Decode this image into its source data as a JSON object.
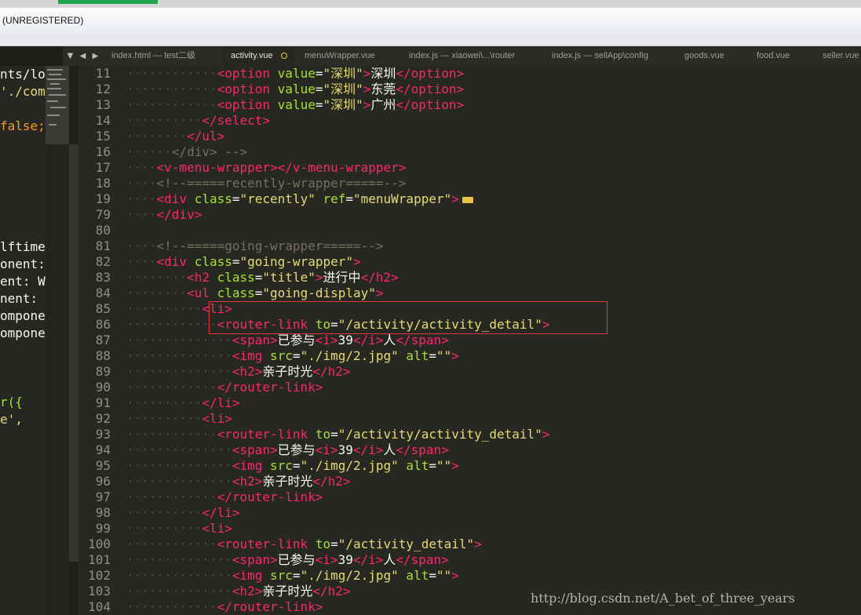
{
  "window": {
    "title": "(UNREGISTERED)"
  },
  "tabs": [
    {
      "label": "index.html — test二级",
      "active": false
    },
    {
      "label": "activity.vue",
      "active": true,
      "modified": true
    },
    {
      "label": "menuWrapper.vue",
      "active": false
    },
    {
      "label": "index.js — xiaowei\\...\\router",
      "active": false
    },
    {
      "label": "index.js — sellApp\\config",
      "active": false
    },
    {
      "label": "goods.vue",
      "active": false
    },
    {
      "label": "food.vue",
      "active": false
    },
    {
      "label": "seller.vue",
      "active": false
    }
  ],
  "tab_nav": {
    "menu": "▼",
    "prev": "◀",
    "next": "▶"
  },
  "side_pane": [
    {
      "text": "nts/lo",
      "kind": "txt"
    },
    {
      "text": "'./com",
      "kind": "str"
    },
    {
      "text": "",
      "kind": "txt"
    },
    {
      "text": "false;",
      "kind": "kw"
    },
    {
      "text": "",
      "kind": "txt"
    },
    {
      "text": "",
      "kind": "txt"
    },
    {
      "text": "",
      "kind": "txt"
    },
    {
      "text": "",
      "kind": "txt"
    },
    {
      "text": "",
      "kind": "txt"
    },
    {
      "text": "",
      "kind": "txt"
    },
    {
      "text": "lftime",
      "kind": "txt"
    },
    {
      "text": "onent:",
      "kind": "txt"
    },
    {
      "text": "ent: W",
      "kind": "txt"
    },
    {
      "text": "nent: ",
      "kind": "txt"
    },
    {
      "text": "ompone",
      "kind": "txt"
    },
    {
      "text": "ompone",
      "kind": "txt"
    },
    {
      "text": "",
      "kind": "txt"
    },
    {
      "text": "",
      "kind": "txt"
    },
    {
      "text": "",
      "kind": "txt"
    },
    {
      "text": "r({",
      "kind": "fn"
    },
    {
      "text": "e',",
      "kind": "str"
    }
  ],
  "code_lines": [
    {
      "n": "11",
      "indent": "············",
      "segs": [
        [
          "tag",
          "<option"
        ],
        [
          "attr",
          " value"
        ],
        [
          "txt",
          "="
        ],
        [
          "str",
          "\"深圳\""
        ],
        [
          "tag",
          ">"
        ],
        [
          "txt",
          "深圳"
        ],
        [
          "tag",
          "</option>"
        ]
      ]
    },
    {
      "n": "12",
      "indent": "············",
      "segs": [
        [
          "tag",
          "<option"
        ],
        [
          "attr",
          " value"
        ],
        [
          "txt",
          "="
        ],
        [
          "str",
          "\"深圳\""
        ],
        [
          "tag",
          ">"
        ],
        [
          "txt",
          "东莞"
        ],
        [
          "tag",
          "</option>"
        ]
      ]
    },
    {
      "n": "13",
      "indent": "············",
      "segs": [
        [
          "tag",
          "<option"
        ],
        [
          "attr",
          " value"
        ],
        [
          "txt",
          "="
        ],
        [
          "str",
          "\"深圳\""
        ],
        [
          "tag",
          ">"
        ],
        [
          "txt",
          "广州"
        ],
        [
          "tag",
          "</option>"
        ]
      ]
    },
    {
      "n": "14",
      "indent": "··········",
      "segs": [
        [
          "tag",
          "</select>"
        ]
      ]
    },
    {
      "n": "15",
      "indent": "········",
      "segs": [
        [
          "tag",
          "</ul>"
        ]
      ]
    },
    {
      "n": "16",
      "indent": "······",
      "segs": [
        [
          "cmt",
          "</div> -->"
        ]
      ]
    },
    {
      "n": "17",
      "indent": "····",
      "segs": [
        [
          "tag",
          "<v-menu-wrapper></v-menu-wrapper>"
        ]
      ]
    },
    {
      "n": "18",
      "indent": "····",
      "segs": [
        [
          "cmt",
          "<!--=====recently-wrapper=====-->"
        ]
      ]
    },
    {
      "n": "19",
      "indent": "····",
      "segs": [
        [
          "tag",
          "<div"
        ],
        [
          "attr",
          " class"
        ],
        [
          "txt",
          "="
        ],
        [
          "str",
          "\"recently\""
        ],
        [
          "attr",
          " ref"
        ],
        [
          "txt",
          "="
        ],
        [
          "str",
          "\"menuWrapper\""
        ],
        [
          "tag",
          ">"
        ],
        [
          "fold",
          ""
        ]
      ]
    },
    {
      "n": "79",
      "indent": "····",
      "segs": [
        [
          "tag",
          "</div>"
        ]
      ]
    },
    {
      "n": "80",
      "indent": "",
      "segs": []
    },
    {
      "n": "81",
      "indent": "····",
      "segs": [
        [
          "cmt",
          "<!--=====going-wrapper=====-->"
        ]
      ]
    },
    {
      "n": "82",
      "indent": "····",
      "segs": [
        [
          "tag",
          "<div"
        ],
        [
          "attr",
          " class"
        ],
        [
          "txt",
          "="
        ],
        [
          "str",
          "\"going-wrapper\""
        ],
        [
          "tag",
          ">"
        ]
      ]
    },
    {
      "n": "83",
      "indent": "········",
      "segs": [
        [
          "tag",
          "<h2"
        ],
        [
          "attr",
          " class"
        ],
        [
          "txt",
          "="
        ],
        [
          "str",
          "\"title\""
        ],
        [
          "tag",
          ">"
        ],
        [
          "txt",
          "进行中"
        ],
        [
          "tag",
          "</h2>"
        ]
      ]
    },
    {
      "n": "84",
      "indent": "········",
      "segs": [
        [
          "tag",
          "<ul"
        ],
        [
          "attr",
          " class"
        ],
        [
          "txt",
          "="
        ],
        [
          "str",
          "\"going-display\""
        ],
        [
          "tag",
          ">"
        ]
      ]
    },
    {
      "n": "85",
      "indent": "··········",
      "segs": [
        [
          "tag",
          "<li>"
        ]
      ]
    },
    {
      "n": "86",
      "indent": "············",
      "segs": [
        [
          "tag",
          "<router-link"
        ],
        [
          "attr",
          " to"
        ],
        [
          "txt",
          "="
        ],
        [
          "str",
          "\"/activity/activity_detail\""
        ],
        [
          "tag",
          ">"
        ]
      ]
    },
    {
      "n": "87",
      "indent": "··············",
      "segs": [
        [
          "tag",
          "<span>"
        ],
        [
          "txt",
          "已参与"
        ],
        [
          "tag",
          "<i>"
        ],
        [
          "txt",
          "39"
        ],
        [
          "tag",
          "</i>"
        ],
        [
          "txt",
          "人"
        ],
        [
          "tag",
          "</span>"
        ]
      ]
    },
    {
      "n": "88",
      "indent": "··············",
      "segs": [
        [
          "tag",
          "<img"
        ],
        [
          "attr",
          " src"
        ],
        [
          "txt",
          "="
        ],
        [
          "str",
          "\"./img/2.jpg\""
        ],
        [
          "attr",
          " alt"
        ],
        [
          "txt",
          "="
        ],
        [
          "str",
          "\"\""
        ],
        [
          "tag",
          ">"
        ]
      ]
    },
    {
      "n": "89",
      "indent": "··············",
      "segs": [
        [
          "tag",
          "<h2>"
        ],
        [
          "txt",
          "亲子时光"
        ],
        [
          "tag",
          "</h2>"
        ]
      ]
    },
    {
      "n": "90",
      "indent": "············",
      "segs": [
        [
          "tag",
          "</router-link>"
        ]
      ]
    },
    {
      "n": "91",
      "indent": "··········",
      "segs": [
        [
          "tag",
          "</li>"
        ]
      ]
    },
    {
      "n": "92",
      "indent": "··········",
      "segs": [
        [
          "tag",
          "<li>"
        ]
      ]
    },
    {
      "n": "93",
      "indent": "············",
      "segs": [
        [
          "tag",
          "<router-link"
        ],
        [
          "attr",
          " to"
        ],
        [
          "txt",
          "="
        ],
        [
          "str",
          "\"/activity/activity_detail\""
        ],
        [
          "tag",
          ">"
        ]
      ]
    },
    {
      "n": "94",
      "indent": "··············",
      "segs": [
        [
          "tag",
          "<span>"
        ],
        [
          "txt",
          "已参与"
        ],
        [
          "tag",
          "<i>"
        ],
        [
          "txt",
          "39"
        ],
        [
          "tag",
          "</i>"
        ],
        [
          "txt",
          "人"
        ],
        [
          "tag",
          "</span>"
        ]
      ]
    },
    {
      "n": "95",
      "indent": "··············",
      "segs": [
        [
          "tag",
          "<img"
        ],
        [
          "attr",
          " src"
        ],
        [
          "txt",
          "="
        ],
        [
          "str",
          "\"./img/2.jpg\""
        ],
        [
          "attr",
          " alt"
        ],
        [
          "txt",
          "="
        ],
        [
          "str",
          "\"\""
        ],
        [
          "tag",
          ">"
        ]
      ]
    },
    {
      "n": "96",
      "indent": "··············",
      "segs": [
        [
          "tag",
          "<h2>"
        ],
        [
          "txt",
          "亲子时光"
        ],
        [
          "tag",
          "</h2>"
        ]
      ]
    },
    {
      "n": "97",
      "indent": "············",
      "segs": [
        [
          "tag",
          "</router-link>"
        ]
      ]
    },
    {
      "n": "98",
      "indent": "··········",
      "segs": [
        [
          "tag",
          "</li>"
        ]
      ]
    },
    {
      "n": "99",
      "indent": "··········",
      "segs": [
        [
          "tag",
          "<li>"
        ]
      ]
    },
    {
      "n": "100",
      "indent": "············",
      "segs": [
        [
          "tag",
          "<router-link"
        ],
        [
          "attr",
          " to"
        ],
        [
          "txt",
          "="
        ],
        [
          "str",
          "\"/activity_detail\""
        ],
        [
          "tag",
          ">"
        ]
      ]
    },
    {
      "n": "101",
      "indent": "··············",
      "segs": [
        [
          "tag",
          "<span>"
        ],
        [
          "txt",
          "已参与"
        ],
        [
          "tag",
          "<i>"
        ],
        [
          "txt",
          "39"
        ],
        [
          "tag",
          "</i>"
        ],
        [
          "txt",
          "人"
        ],
        [
          "tag",
          "</span>"
        ]
      ]
    },
    {
      "n": "102",
      "indent": "··············",
      "segs": [
        [
          "tag",
          "<img"
        ],
        [
          "attr",
          " src"
        ],
        [
          "txt",
          "="
        ],
        [
          "str",
          "\"./img/2.jpg\""
        ],
        [
          "attr",
          " alt"
        ],
        [
          "txt",
          "="
        ],
        [
          "str",
          "\"\""
        ],
        [
          "tag",
          ">"
        ]
      ]
    },
    {
      "n": "103",
      "indent": "··············",
      "segs": [
        [
          "tag",
          "<h2>"
        ],
        [
          "txt",
          "亲子时光"
        ],
        [
          "tag",
          "</h2>"
        ]
      ]
    },
    {
      "n": "104",
      "indent": "············",
      "segs": [
        [
          "tag",
          "</router-link>"
        ]
      ]
    }
  ],
  "watermark": "http://blog.csdn.net/A_bet_of_three_years",
  "colors": {
    "editor_bg": "#272822",
    "tag": "#f92672",
    "attribute": "#a6e22e",
    "string": "#e6db74",
    "comment": "#75715e",
    "text": "#f8f8f2",
    "highlight_box": "#e23a3a",
    "modified_dot": "#e8c34a"
  }
}
